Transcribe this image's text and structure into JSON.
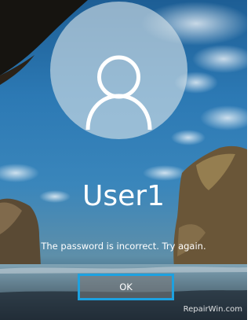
{
  "lock_screen": {
    "username": "User1",
    "message": "The password is incorrect. Try again.",
    "ok_label": "OK",
    "watermark": "RepairWin.com",
    "avatar_icon": "user-icon"
  },
  "colors": {
    "accent_border": "#1da1e0",
    "text": "#ffffff"
  }
}
